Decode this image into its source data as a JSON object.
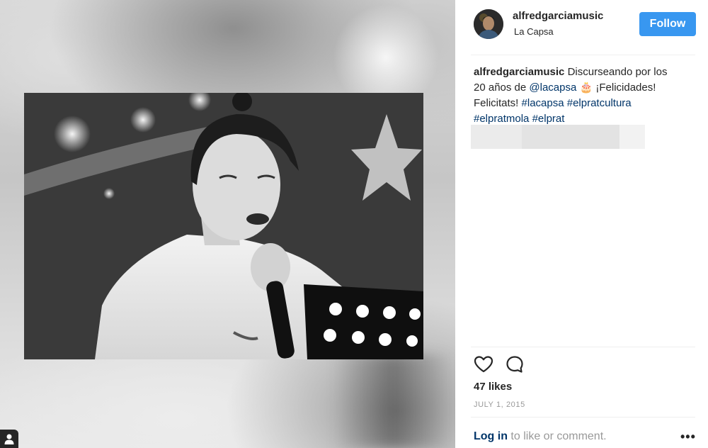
{
  "post": {
    "username": "alfredgarciamusic",
    "location": "La Capsa",
    "follow_label": "Follow",
    "caption": {
      "user": "alfredgarciamusic",
      "text_1": " Discurseando por los 20 años de ",
      "mention": "@lacapsa",
      "emoji": " 🎂 ",
      "text_2": "¡Felicidades! Felicitats! ",
      "tags": [
        "#lacapsa",
        "#elpratcultura",
        "#elpratmola",
        "#elprat"
      ]
    },
    "likes": "47 likes",
    "date": "July 1, 2015",
    "login_link": "Log in",
    "login_suffix": " to like or comment.",
    "more_label": "•••"
  },
  "icons": {
    "like": "heart-outline-icon",
    "comment": "speech-bubble-icon",
    "profile_chip": "person-icon"
  },
  "colors": {
    "accent": "#3897f0",
    "link": "#003569",
    "muted": "#999999",
    "text": "#262626"
  }
}
